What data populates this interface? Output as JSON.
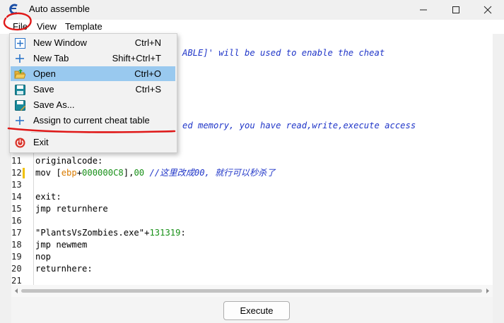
{
  "window": {
    "title": "Auto assemble"
  },
  "menubar": [
    "File",
    "View",
    "Template"
  ],
  "file_menu": [
    {
      "label": "New Window",
      "shortcut": "Ctrl+N",
      "icon": "new-window-icon"
    },
    {
      "label": "New Tab",
      "shortcut": "Shift+Ctrl+T",
      "icon": "plus-icon"
    },
    {
      "label": "Open",
      "shortcut": "Ctrl+O",
      "icon": "open-folder-icon",
      "highlighted": true
    },
    {
      "label": "Save",
      "shortcut": "Ctrl+S",
      "icon": "save-icon"
    },
    {
      "label": "Save As...",
      "shortcut": "",
      "icon": "save-as-icon"
    },
    {
      "label": "Assign to current cheat table",
      "shortcut": "",
      "icon": "plus-icon"
    },
    {
      "label": "Exit",
      "shortcut": "",
      "icon": "power-icon"
    }
  ],
  "editor": {
    "lines": [
      {
        "n": "",
        "parts": [
          {
            "t": "ABLE]' will be used to enable the cheat",
            "c": "comment"
          }
        ],
        "partial": true
      },
      {
        "n": "",
        "parts": [
          {
            "t": "ed memory, you have read,write,execute access",
            "c": "comment"
          }
        ],
        "partial": true
      },
      {
        "n": "11",
        "parts": [
          {
            "t": "originalcode:",
            "c": "plain"
          }
        ]
      },
      {
        "n": "12",
        "mark": true,
        "parts": [
          {
            "t": "mov [",
            "c": "plain"
          },
          {
            "t": "ebp",
            "c": "reg"
          },
          {
            "t": "+",
            "c": "plain"
          },
          {
            "t": "000000C8",
            "c": "num"
          },
          {
            "t": "],",
            "c": "plain"
          },
          {
            "t": "00",
            "c": "num"
          },
          {
            "t": " //这里改成00, 就行可以秒杀了",
            "c": "comment"
          }
        ]
      },
      {
        "n": "13",
        "parts": []
      },
      {
        "n": "14",
        "parts": [
          {
            "t": "exit:",
            "c": "plain"
          }
        ]
      },
      {
        "n": "15",
        "parts": [
          {
            "t": "jmp returnhere",
            "c": "plain"
          }
        ]
      },
      {
        "n": "16",
        "parts": []
      },
      {
        "n": "17",
        "parts": [
          {
            "t": "\"PlantsVsZombies.exe\"+",
            "c": "plain"
          },
          {
            "t": "131319",
            "c": "num"
          },
          {
            "t": ":",
            "c": "plain"
          }
        ]
      },
      {
        "n": "18",
        "parts": [
          {
            "t": "jmp newmem",
            "c": "plain"
          }
        ]
      },
      {
        "n": "19",
        "parts": [
          {
            "t": "nop",
            "c": "plain"
          }
        ]
      },
      {
        "n": "20",
        "parts": [
          {
            "t": "returnhere:",
            "c": "plain"
          }
        ]
      },
      {
        "n": "21",
        "parts": []
      }
    ]
  },
  "execute_button": "Execute",
  "colors": {
    "comment": "#1f35c8",
    "reg": "#d97b00",
    "num": "#189018",
    "highlight": "#99c9ef",
    "annotation": "#e01818"
  }
}
